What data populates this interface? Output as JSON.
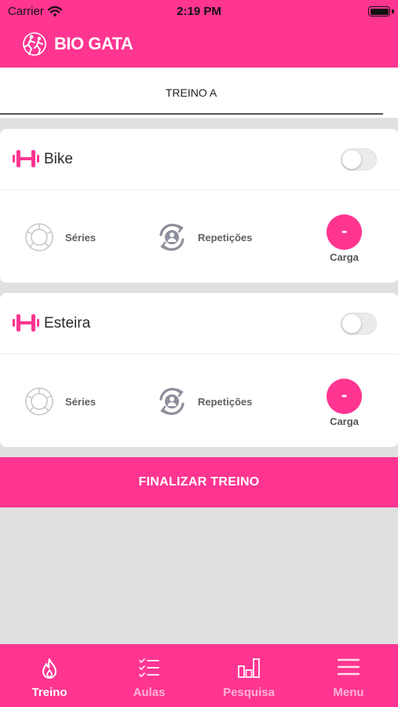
{
  "status_bar": {
    "carrier": "Carrier",
    "time": "2:19 PM"
  },
  "header": {
    "logo_text": "BIO GATA"
  },
  "tab": {
    "label": "TREINO A"
  },
  "exercises": [
    {
      "name": "Bike",
      "series_label": "Séries",
      "reps_label": "Repetições",
      "carga_value": "-",
      "carga_label": "Carga",
      "enabled": false
    },
    {
      "name": "Esteira",
      "series_label": "Séries",
      "reps_label": "Repetições",
      "carga_value": "-",
      "carga_label": "Carga",
      "enabled": false
    }
  ],
  "finish_button": {
    "label": "FINALIZAR TREINO"
  },
  "bottom_nav": [
    {
      "label": "Treino",
      "icon": "flame-icon",
      "active": true
    },
    {
      "label": "Aulas",
      "icon": "checklist-icon",
      "active": false
    },
    {
      "label": "Pesquisa",
      "icon": "bar-chart-icon",
      "active": false
    },
    {
      "label": "Menu",
      "icon": "hamburger-menu-icon",
      "active": false
    }
  ],
  "colors": {
    "accent": "#ff3591",
    "background": "#e0e0e0"
  }
}
